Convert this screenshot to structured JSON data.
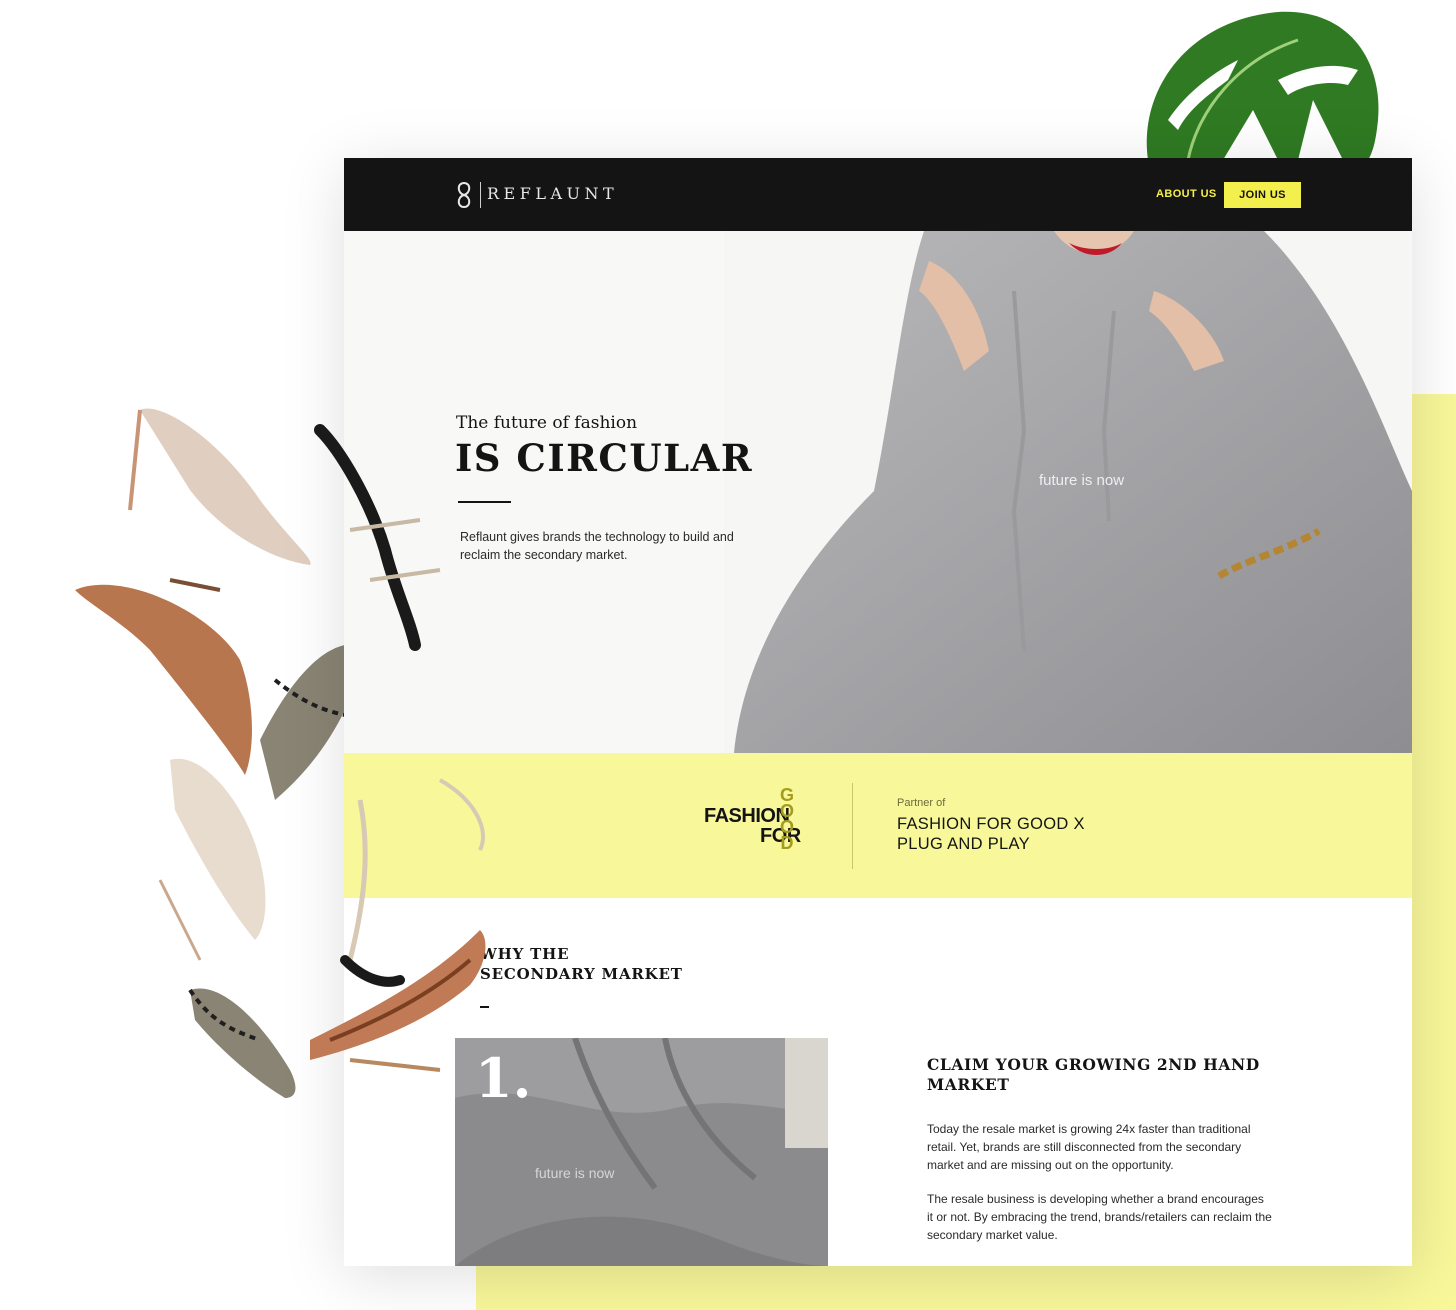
{
  "header": {
    "logo_text": "REFLAUNT",
    "nav": {
      "about_label": "ABOUT US",
      "join_label": "JOIN US"
    }
  },
  "hero": {
    "small_title": "The future of fashion",
    "title": "IS CIRCULAR",
    "description": "Reflaunt gives brands the technology to build and reclaim the secondary market.",
    "hoodie_print": "future is now"
  },
  "partner": {
    "logo_words": [
      "FASHION",
      "FOR",
      "GOOD"
    ],
    "label": "Partner of",
    "name_line1": "FASHION FOR GOOD X",
    "name_line2": "PLUG AND PLAY"
  },
  "why": {
    "title_line1": "WHY THE",
    "title_line2": "SECONDARY MARKET",
    "card": {
      "number": "1.",
      "image_print": "future is now",
      "heading": "CLAIM YOUR GROWING 2ND HAND MARKET",
      "para1": "Today the resale market is growing 24x faster than traditional retail. Yet, brands are still disconnected from the secondary market and are missing out on the opportunity.",
      "para2": "The resale business is developing whether a brand encourages it or not. By embracing the trend, brands/retailers can reclaim the secondary market value."
    }
  },
  "colors": {
    "accent_yellow": "#f3ef4c",
    "band_yellow": "#f8f79a",
    "dark": "#141414"
  },
  "icons": [
    "reflaunt-logo-icon",
    "monstera-leaf-icon",
    "high-heel-shoe-icon"
  ]
}
